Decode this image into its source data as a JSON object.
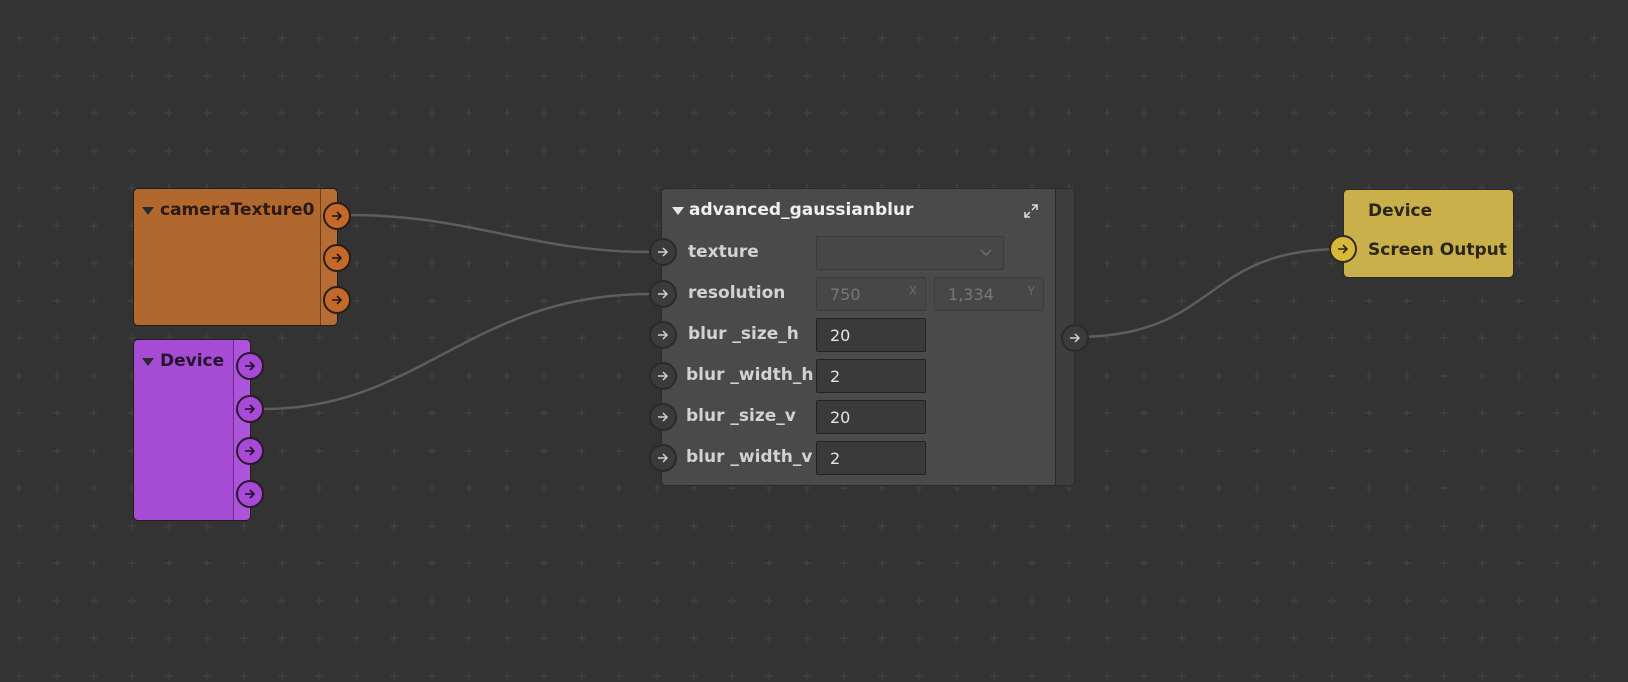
{
  "graph": {
    "camera_node": {
      "title": "cameraTexture0",
      "color": "#b0682f"
    },
    "device_node": {
      "title": "Device",
      "color": "#a64bd3"
    },
    "blur_node": {
      "title": "advanced_gaussianblur",
      "expand_icon": "expand-icon",
      "params": [
        {
          "label": "texture",
          "value": ""
        },
        {
          "label": "resolution",
          "x_value": "750",
          "x_axis": "X",
          "y_value": "1,334",
          "y_axis": "Y"
        },
        {
          "label": "blur _size_h",
          "value": "20"
        },
        {
          "label": "blur _width_h",
          "value": "2"
        },
        {
          "label": "blur _size_v",
          "value": "20"
        },
        {
          "label": "blur _width_v",
          "value": "2"
        }
      ]
    },
    "output_node": {
      "title": "Device",
      "port_label": "Screen Output",
      "color": "#cab04a"
    }
  }
}
